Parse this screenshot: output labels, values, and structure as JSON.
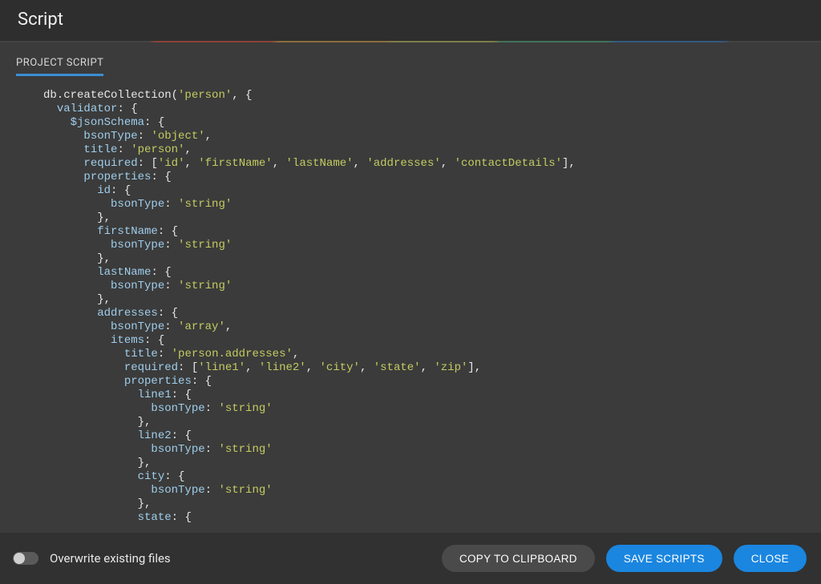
{
  "header": {
    "title": "Script"
  },
  "tabs": {
    "project_script": "PROJECT SCRIPT"
  },
  "code": {
    "lines": [
      [
        [
          "default",
          "db.createCollection("
        ],
        [
          "string",
          "'person'"
        ],
        [
          "default",
          ", {"
        ]
      ],
      [
        [
          "default",
          "  "
        ],
        [
          "key",
          "validator"
        ],
        [
          "default",
          ": {"
        ]
      ],
      [
        [
          "default",
          "    "
        ],
        [
          "key",
          "$jsonSchema"
        ],
        [
          "default",
          ": {"
        ]
      ],
      [
        [
          "default",
          "      "
        ],
        [
          "key",
          "bsonType"
        ],
        [
          "default",
          ": "
        ],
        [
          "string",
          "'object'"
        ],
        [
          "default",
          ","
        ]
      ],
      [
        [
          "default",
          "      "
        ],
        [
          "key",
          "title"
        ],
        [
          "default",
          ": "
        ],
        [
          "string",
          "'person'"
        ],
        [
          "default",
          ","
        ]
      ],
      [
        [
          "default",
          "      "
        ],
        [
          "key",
          "required"
        ],
        [
          "default",
          ": ["
        ],
        [
          "string",
          "'id'"
        ],
        [
          "default",
          ", "
        ],
        [
          "string",
          "'firstName'"
        ],
        [
          "default",
          ", "
        ],
        [
          "string",
          "'lastName'"
        ],
        [
          "default",
          ", "
        ],
        [
          "string",
          "'addresses'"
        ],
        [
          "default",
          ", "
        ],
        [
          "string",
          "'contactDetails'"
        ],
        [
          "default",
          "],"
        ]
      ],
      [
        [
          "default",
          "      "
        ],
        [
          "key",
          "properties"
        ],
        [
          "default",
          ": {"
        ]
      ],
      [
        [
          "default",
          "        "
        ],
        [
          "key",
          "id"
        ],
        [
          "default",
          ": {"
        ]
      ],
      [
        [
          "default",
          "          "
        ],
        [
          "key",
          "bsonType"
        ],
        [
          "default",
          ": "
        ],
        [
          "string",
          "'string'"
        ]
      ],
      [
        [
          "default",
          "        },"
        ]
      ],
      [
        [
          "default",
          "        "
        ],
        [
          "key",
          "firstName"
        ],
        [
          "default",
          ": {"
        ]
      ],
      [
        [
          "default",
          "          "
        ],
        [
          "key",
          "bsonType"
        ],
        [
          "default",
          ": "
        ],
        [
          "string",
          "'string'"
        ]
      ],
      [
        [
          "default",
          "        },"
        ]
      ],
      [
        [
          "default",
          "        "
        ],
        [
          "key",
          "lastName"
        ],
        [
          "default",
          ": {"
        ]
      ],
      [
        [
          "default",
          "          "
        ],
        [
          "key",
          "bsonType"
        ],
        [
          "default",
          ": "
        ],
        [
          "string",
          "'string'"
        ]
      ],
      [
        [
          "default",
          "        },"
        ]
      ],
      [
        [
          "default",
          "        "
        ],
        [
          "key",
          "addresses"
        ],
        [
          "default",
          ": {"
        ]
      ],
      [
        [
          "default",
          "          "
        ],
        [
          "key",
          "bsonType"
        ],
        [
          "default",
          ": "
        ],
        [
          "string",
          "'array'"
        ],
        [
          "default",
          ","
        ]
      ],
      [
        [
          "default",
          "          "
        ],
        [
          "key",
          "items"
        ],
        [
          "default",
          ": {"
        ]
      ],
      [
        [
          "default",
          "            "
        ],
        [
          "key",
          "title"
        ],
        [
          "default",
          ": "
        ],
        [
          "string",
          "'person.addresses'"
        ],
        [
          "default",
          ","
        ]
      ],
      [
        [
          "default",
          "            "
        ],
        [
          "key",
          "required"
        ],
        [
          "default",
          ": ["
        ],
        [
          "string",
          "'line1'"
        ],
        [
          "default",
          ", "
        ],
        [
          "string",
          "'line2'"
        ],
        [
          "default",
          ", "
        ],
        [
          "string",
          "'city'"
        ],
        [
          "default",
          ", "
        ],
        [
          "string",
          "'state'"
        ],
        [
          "default",
          ", "
        ],
        [
          "string",
          "'zip'"
        ],
        [
          "default",
          "],"
        ]
      ],
      [
        [
          "default",
          "            "
        ],
        [
          "key",
          "properties"
        ],
        [
          "default",
          ": {"
        ]
      ],
      [
        [
          "default",
          "              "
        ],
        [
          "key",
          "line1"
        ],
        [
          "default",
          ": {"
        ]
      ],
      [
        [
          "default",
          "                "
        ],
        [
          "key",
          "bsonType"
        ],
        [
          "default",
          ": "
        ],
        [
          "string",
          "'string'"
        ]
      ],
      [
        [
          "default",
          "              },"
        ]
      ],
      [
        [
          "default",
          "              "
        ],
        [
          "key",
          "line2"
        ],
        [
          "default",
          ": {"
        ]
      ],
      [
        [
          "default",
          "                "
        ],
        [
          "key",
          "bsonType"
        ],
        [
          "default",
          ": "
        ],
        [
          "string",
          "'string'"
        ]
      ],
      [
        [
          "default",
          "              },"
        ]
      ],
      [
        [
          "default",
          "              "
        ],
        [
          "key",
          "city"
        ],
        [
          "default",
          ": {"
        ]
      ],
      [
        [
          "default",
          "                "
        ],
        [
          "key",
          "bsonType"
        ],
        [
          "default",
          ": "
        ],
        [
          "string",
          "'string'"
        ]
      ],
      [
        [
          "default",
          "              },"
        ]
      ],
      [
        [
          "default",
          "              "
        ],
        [
          "key",
          "state"
        ],
        [
          "default",
          ": {"
        ]
      ]
    ]
  },
  "footer": {
    "overwrite_label": "Overwrite existing files",
    "copy_label": "COPY TO CLIPBOARD",
    "save_label": "SAVE SCRIPTS",
    "close_label": "CLOSE"
  }
}
